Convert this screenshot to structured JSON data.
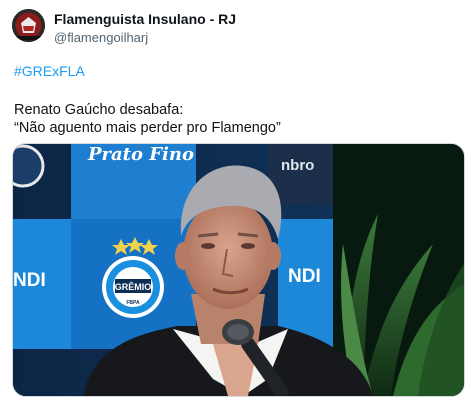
{
  "author": {
    "display_name": "Flamenguista Insulano - RJ",
    "handle": "@flamengoilharj"
  },
  "tweet": {
    "hashtag": "#GRExFLA",
    "text_line_1": "Renato Gaúcho desabafa:",
    "text_line_2": "“Não aguento mais perder pro Flamengo”"
  },
  "media": {
    "sponsor_top": "Prato Fino",
    "sponsor_right_top": "nbro",
    "sponsor_left": "NDI",
    "sponsor_right": "NDI",
    "crest_text": "GRÊMIO",
    "crest_small": "FBPA"
  },
  "colors": {
    "link": "#1d9bf0",
    "secondary_text": "#536471",
    "panel_blue": "#1e88d8",
    "panel_dark": "#0d2f56"
  }
}
